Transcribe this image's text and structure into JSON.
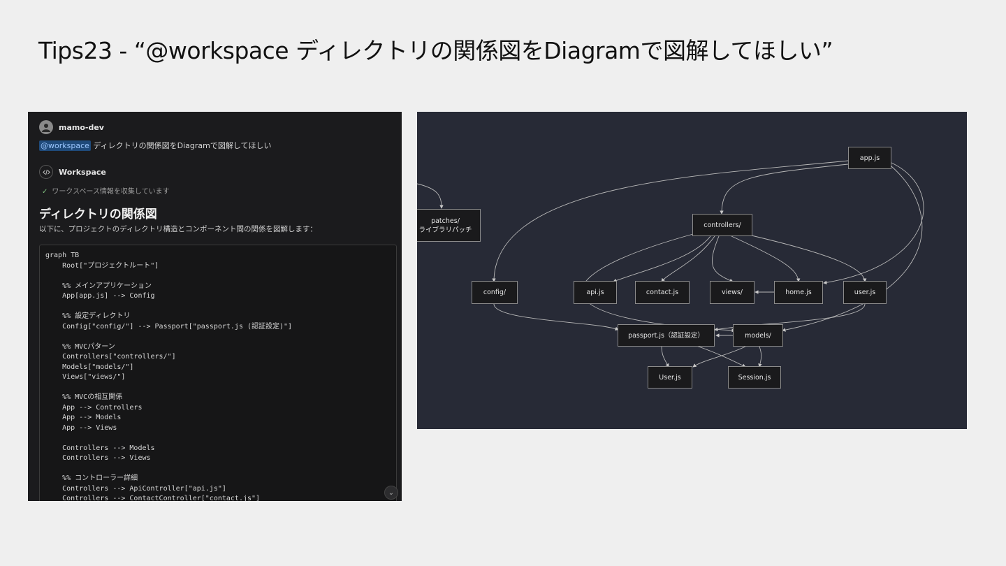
{
  "slide": {
    "title": "Tips23 - “@workspace ディレクトリの関係図をDiagramで図解してほしい”"
  },
  "chat": {
    "username": "mamo-dev",
    "mention": "@workspace",
    "prompt": " ディレクトリの関係図をDiagramで図解してほしい",
    "agent_name": "Workspace",
    "progress": "ワークスペース情報を収集しています",
    "heading": "ディレクトリの関係図",
    "description": "以下に、プロジェクトのディレクトリ構造とコンポーネント間の関係を図解します：",
    "code_lines": [
      "graph TB",
      "    Root[\"プロジェクトルート\"]",
      "",
      "    %% メインアプリケーション",
      "    App[app.js] --> Config",
      "",
      "    %% 設定ディレクトリ",
      "    Config[\"config/\"] --> Passport[\"passport.js (認証設定)\"]",
      "",
      "    %% MVCパターン",
      "    Controllers[\"controllers/\"]",
      "    Models[\"models/\"]",
      "    Views[\"views/\"]",
      "",
      "    %% MVCの相互関係",
      "    App --> Controllers",
      "    App --> Models",
      "    App --> Views",
      "",
      "    Controllers --> Models",
      "    Controllers --> Views",
      "",
      "    %% コントローラー詳細",
      "    Controllers --> ApiController[\"api.js\"]",
      "    Controllers --> ContactController[\"contact.js\"]"
    ]
  },
  "diagram": {
    "nodes": {
      "app": "app.js",
      "patches_1": "patches/",
      "patches_2": "ライブラリパッチ",
      "controllers": "controllers/",
      "config": "config/",
      "api": "api.js",
      "contact": "contact.js",
      "views": "views/",
      "home": "home.js",
      "user": "user.js",
      "passport": "passport.js（認証設定）",
      "models": "models/",
      "userModel": "User.js",
      "session": "Session.js"
    }
  }
}
